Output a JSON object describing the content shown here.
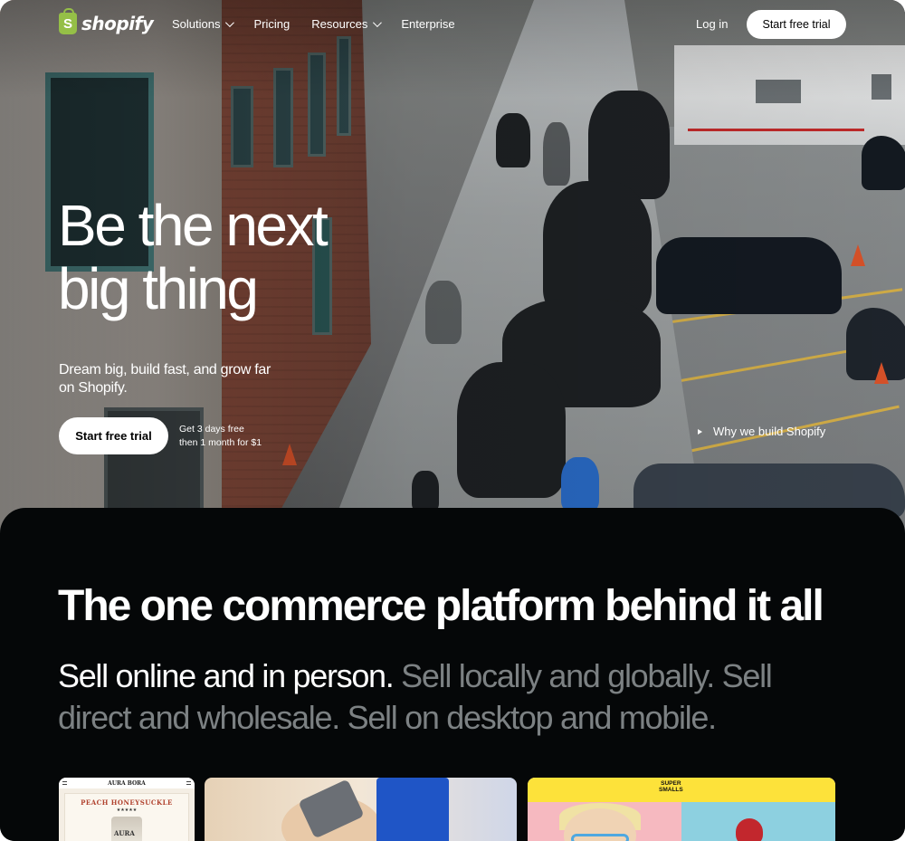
{
  "nav": {
    "logo_text": "shopify",
    "logo_mark": "S",
    "links": [
      {
        "label": "Solutions",
        "has_dropdown": true
      },
      {
        "label": "Pricing",
        "has_dropdown": false
      },
      {
        "label": "Resources",
        "has_dropdown": true
      },
      {
        "label": "Enterprise",
        "has_dropdown": false
      }
    ],
    "login": "Log in",
    "cta": "Start free trial"
  },
  "hero": {
    "headline_line1": "Be the next",
    "headline_line2": "big thing",
    "subtitle": "Dream big, build fast, and grow far on Shopify.",
    "cta": "Start free trial",
    "trial_note_line1": "Get 3 days free",
    "trial_note_line2": "then 1 month for $1",
    "video_link": "Why we build Shopify"
  },
  "section": {
    "title": "The one commerce platform behind it all",
    "body_bright": "Sell online and in person.",
    "body_dim": " Sell locally and globally. Sell direct and wholesale. Sell on desktop and mobile."
  },
  "cards": {
    "card1": {
      "brand": "AURA BORA",
      "product": "PEACH HONEYSUCKLE",
      "stars": "★★★★★",
      "jar_label": "AURA"
    },
    "card3": {
      "brand_line1": "SUPER",
      "brand_line2": "SMALLS"
    }
  },
  "colors": {
    "brand_green": "#95bf47",
    "panel_bg": "#050708",
    "dim_text": "#7c8183"
  }
}
